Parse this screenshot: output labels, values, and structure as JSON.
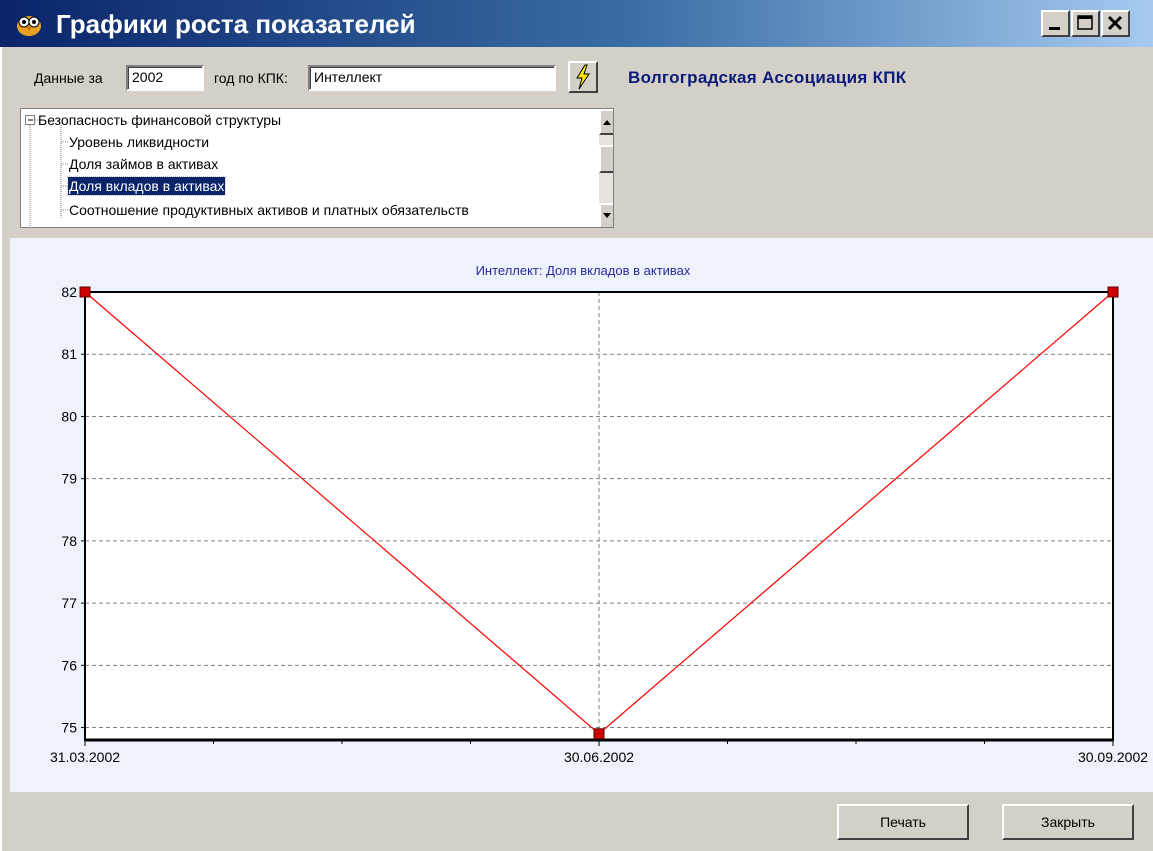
{
  "window": {
    "title": "Графики роста показателей",
    "icon": "owl-app-icon",
    "controls": [
      "minimize-icon",
      "maximize-icon",
      "close-icon"
    ]
  },
  "filter": {
    "data_for_label": "Данные за",
    "year_value": "2002",
    "year_kpk_label": "год по КПК:",
    "kpk_value": "Интеллект",
    "apply_icon": "lightning-icon",
    "association": "Волгоградская Ассоциация КПК"
  },
  "tree": {
    "root": "Безопасность финансовой структуры",
    "items": [
      "Уровень ликвидности",
      "Доля займов в активах",
      "Доля вкладов в активах",
      "Соотношение продуктивных активов и платных обязательств"
    ],
    "selected_index": 2
  },
  "chart_data": {
    "type": "line",
    "title": "Интеллект: Доля вкладов в активах",
    "categories": [
      "31.03.2002",
      "30.06.2002",
      "30.09.2002"
    ],
    "values": [
      82,
      74.9,
      82
    ],
    "ylim": [
      74.8,
      82
    ],
    "yticks": [
      75,
      76,
      77,
      78,
      79,
      80,
      81,
      82
    ],
    "grid": true,
    "colors": {
      "line": "#ff0000",
      "marker": "#cc0000",
      "title": "#2a2aa0"
    }
  },
  "buttons": {
    "print": "Печать",
    "close": "Закрыть"
  }
}
